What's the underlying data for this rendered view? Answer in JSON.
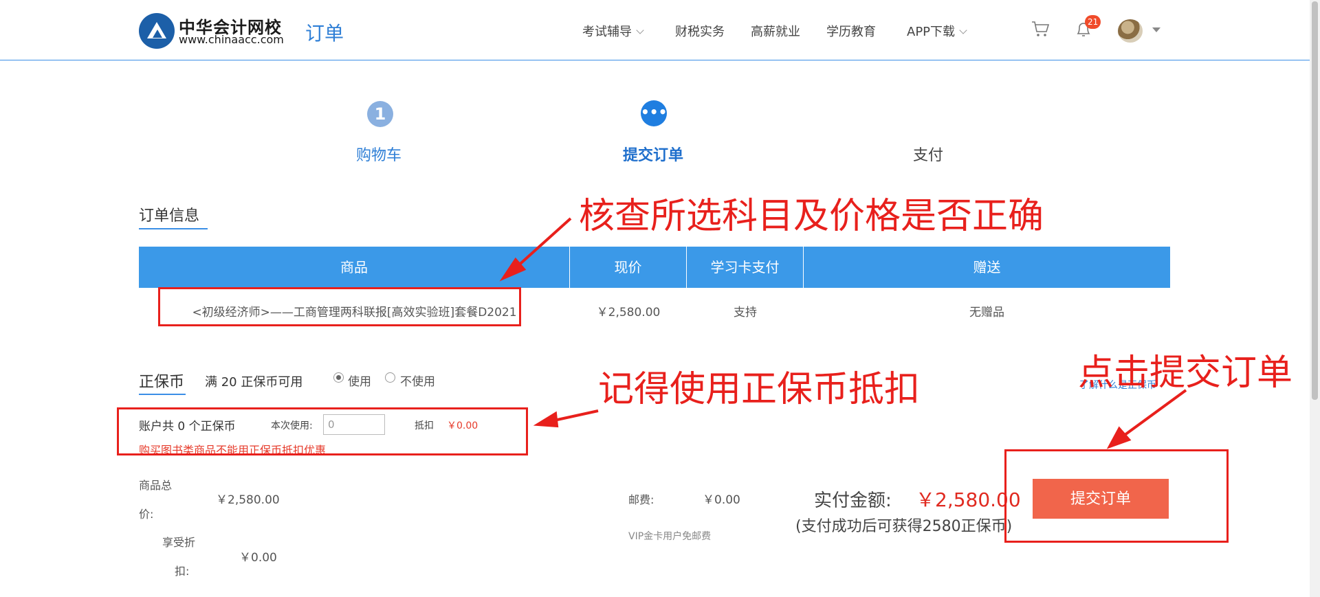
{
  "header": {
    "logo_name": "中华会计网校",
    "logo_url": "www.chinaacc.com",
    "page_name": "订单",
    "nav": [
      "考试辅导",
      "财税实务",
      "高薪就业",
      "学历教育",
      "APP下载"
    ],
    "notification_count": "21"
  },
  "steps": {
    "step1_number": "1",
    "step2_icon": "•••",
    "labels": [
      "购物车",
      "提交订单",
      "支付"
    ]
  },
  "order": {
    "title": "订单信息",
    "columns": [
      "商品",
      "现价",
      "学习卡支付",
      "赠送"
    ],
    "rows": [
      {
        "product": "<初级经济师>——工商管理两科联报[高效实验班]套餐D2021",
        "price": "￥2,580.00",
        "card_pay": "支持",
        "gift": "无赠品"
      }
    ]
  },
  "coins": {
    "title": "正保币",
    "available_note": "满 20 正保币可用",
    "option_use": "使用",
    "option_not_use": "不使用",
    "help_link": "了解什么是正保币",
    "account_total": "账户共 0 个正保币",
    "use_label": "本次使用:",
    "use_value": "0",
    "deduct_label": "抵扣",
    "deduct_value": "￥0.00",
    "book_note": "购买图书类商品不能用正保币抵扣优惠"
  },
  "totals": {
    "goods_total_label_1": "商品总",
    "goods_total_label_2": "价:",
    "goods_total_value": "￥2,580.00",
    "discount_label_1": "享受折",
    "discount_label_2": "扣:",
    "discount_value": "￥0.00",
    "shipping_label": "邮费:",
    "shipping_value": "￥0.00",
    "vip_note": "VIP金卡用户免邮费",
    "pay_label": "实付金额:",
    "pay_value": "￥2,580.00",
    "pay_note": "(支付成功后可获得2580正保币)",
    "submit_label": "提交订单"
  },
  "annotations": {
    "check_items": "核查所选科目及价格是否正确",
    "use_coins": "记得使用正保币抵扣",
    "click_submit": "点击提交订单"
  },
  "colors": {
    "accent": "#3b99e8",
    "annotation_red": "#e8201c",
    "submit_orange": "#f1654b",
    "price_red": "#e02a20"
  }
}
